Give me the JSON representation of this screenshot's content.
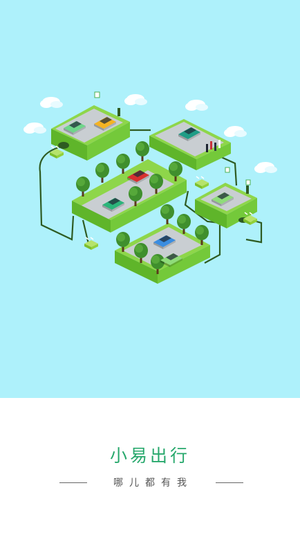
{
  "brand": {
    "app_name": "小易出行",
    "slogan": "哪儿都有我"
  },
  "colors": {
    "sky": "#aef1fb",
    "brand_green": "#27a86c",
    "slogan_gray": "#555555",
    "grass": "#7ccf3b",
    "road": "#c9ced2"
  },
  "illustration": {
    "icons": [
      "cloud-icon",
      "tree-icon",
      "car-icon",
      "charging-station-icon",
      "power-plug-icon",
      "pedestrian-icon"
    ]
  }
}
